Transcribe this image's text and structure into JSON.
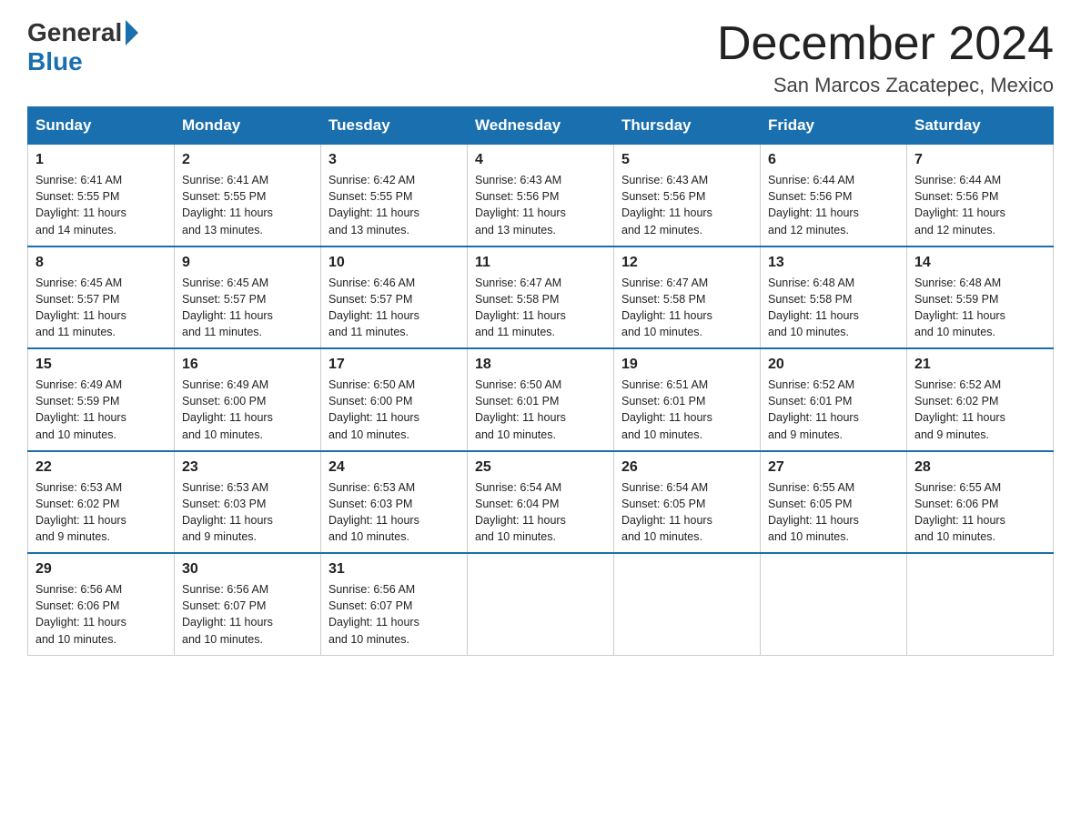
{
  "logo": {
    "text_general": "General",
    "text_blue": "Blue"
  },
  "title": "December 2024",
  "location": "San Marcos Zacatepec, Mexico",
  "days_of_week": [
    "Sunday",
    "Monday",
    "Tuesday",
    "Wednesday",
    "Thursday",
    "Friday",
    "Saturday"
  ],
  "weeks": [
    [
      {
        "day": "1",
        "sunrise": "6:41 AM",
        "sunset": "5:55 PM",
        "daylight": "11 hours and 14 minutes."
      },
      {
        "day": "2",
        "sunrise": "6:41 AM",
        "sunset": "5:55 PM",
        "daylight": "11 hours and 13 minutes."
      },
      {
        "day": "3",
        "sunrise": "6:42 AM",
        "sunset": "5:55 PM",
        "daylight": "11 hours and 13 minutes."
      },
      {
        "day": "4",
        "sunrise": "6:43 AM",
        "sunset": "5:56 PM",
        "daylight": "11 hours and 13 minutes."
      },
      {
        "day": "5",
        "sunrise": "6:43 AM",
        "sunset": "5:56 PM",
        "daylight": "11 hours and 12 minutes."
      },
      {
        "day": "6",
        "sunrise": "6:44 AM",
        "sunset": "5:56 PM",
        "daylight": "11 hours and 12 minutes."
      },
      {
        "day": "7",
        "sunrise": "6:44 AM",
        "sunset": "5:56 PM",
        "daylight": "11 hours and 12 minutes."
      }
    ],
    [
      {
        "day": "8",
        "sunrise": "6:45 AM",
        "sunset": "5:57 PM",
        "daylight": "11 hours and 11 minutes."
      },
      {
        "day": "9",
        "sunrise": "6:45 AM",
        "sunset": "5:57 PM",
        "daylight": "11 hours and 11 minutes."
      },
      {
        "day": "10",
        "sunrise": "6:46 AM",
        "sunset": "5:57 PM",
        "daylight": "11 hours and 11 minutes."
      },
      {
        "day": "11",
        "sunrise": "6:47 AM",
        "sunset": "5:58 PM",
        "daylight": "11 hours and 11 minutes."
      },
      {
        "day": "12",
        "sunrise": "6:47 AM",
        "sunset": "5:58 PM",
        "daylight": "11 hours and 10 minutes."
      },
      {
        "day": "13",
        "sunrise": "6:48 AM",
        "sunset": "5:58 PM",
        "daylight": "11 hours and 10 minutes."
      },
      {
        "day": "14",
        "sunrise": "6:48 AM",
        "sunset": "5:59 PM",
        "daylight": "11 hours and 10 minutes."
      }
    ],
    [
      {
        "day": "15",
        "sunrise": "6:49 AM",
        "sunset": "5:59 PM",
        "daylight": "11 hours and 10 minutes."
      },
      {
        "day": "16",
        "sunrise": "6:49 AM",
        "sunset": "6:00 PM",
        "daylight": "11 hours and 10 minutes."
      },
      {
        "day": "17",
        "sunrise": "6:50 AM",
        "sunset": "6:00 PM",
        "daylight": "11 hours and 10 minutes."
      },
      {
        "day": "18",
        "sunrise": "6:50 AM",
        "sunset": "6:01 PM",
        "daylight": "11 hours and 10 minutes."
      },
      {
        "day": "19",
        "sunrise": "6:51 AM",
        "sunset": "6:01 PM",
        "daylight": "11 hours and 10 minutes."
      },
      {
        "day": "20",
        "sunrise": "6:52 AM",
        "sunset": "6:01 PM",
        "daylight": "11 hours and 9 minutes."
      },
      {
        "day": "21",
        "sunrise": "6:52 AM",
        "sunset": "6:02 PM",
        "daylight": "11 hours and 9 minutes."
      }
    ],
    [
      {
        "day": "22",
        "sunrise": "6:53 AM",
        "sunset": "6:02 PM",
        "daylight": "11 hours and 9 minutes."
      },
      {
        "day": "23",
        "sunrise": "6:53 AM",
        "sunset": "6:03 PM",
        "daylight": "11 hours and 9 minutes."
      },
      {
        "day": "24",
        "sunrise": "6:53 AM",
        "sunset": "6:03 PM",
        "daylight": "11 hours and 10 minutes."
      },
      {
        "day": "25",
        "sunrise": "6:54 AM",
        "sunset": "6:04 PM",
        "daylight": "11 hours and 10 minutes."
      },
      {
        "day": "26",
        "sunrise": "6:54 AM",
        "sunset": "6:05 PM",
        "daylight": "11 hours and 10 minutes."
      },
      {
        "day": "27",
        "sunrise": "6:55 AM",
        "sunset": "6:05 PM",
        "daylight": "11 hours and 10 minutes."
      },
      {
        "day": "28",
        "sunrise": "6:55 AM",
        "sunset": "6:06 PM",
        "daylight": "11 hours and 10 minutes."
      }
    ],
    [
      {
        "day": "29",
        "sunrise": "6:56 AM",
        "sunset": "6:06 PM",
        "daylight": "11 hours and 10 minutes."
      },
      {
        "day": "30",
        "sunrise": "6:56 AM",
        "sunset": "6:07 PM",
        "daylight": "11 hours and 10 minutes."
      },
      {
        "day": "31",
        "sunrise": "6:56 AM",
        "sunset": "6:07 PM",
        "daylight": "11 hours and 10 minutes."
      },
      null,
      null,
      null,
      null
    ]
  ],
  "labels": {
    "sunrise": "Sunrise:",
    "sunset": "Sunset:",
    "daylight": "Daylight:"
  }
}
